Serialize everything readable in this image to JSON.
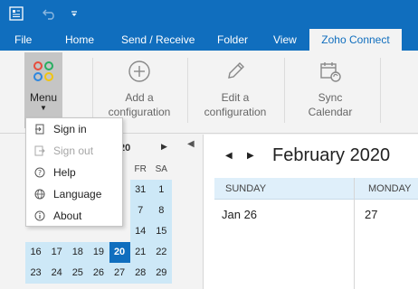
{
  "quick_access": {
    "app_icon": "outlook-icon",
    "undo_icon": "undo-icon",
    "customize_icon": "chevron-down-icon"
  },
  "tabs": [
    {
      "label": "File"
    },
    {
      "label": "Home"
    },
    {
      "label": "Send / Receive"
    },
    {
      "label": "Folder"
    },
    {
      "label": "View"
    },
    {
      "label": "Zoho Connect",
      "active": true
    }
  ],
  "ribbon": {
    "menu_label": "Menu",
    "add_line1": "Add a",
    "add_line2": "configuration",
    "edit_line1": "Edit a",
    "edit_line2": "configuration",
    "sync_line1": "Sync",
    "sync_line2": "Calendar"
  },
  "dropdown": {
    "items": [
      {
        "label": "Sign in",
        "icon": "sign-in-icon",
        "enabled": true
      },
      {
        "label": "Sign out",
        "icon": "sign-out-icon",
        "enabled": false
      },
      {
        "label": "Help",
        "icon": "help-icon",
        "enabled": true
      },
      {
        "label": "Language",
        "icon": "globe-icon",
        "enabled": true
      },
      {
        "label": "About",
        "icon": "info-icon",
        "enabled": true
      }
    ]
  },
  "mini_calendar": {
    "header_day": "20",
    "dow": [
      "",
      "",
      "",
      "",
      "FR",
      "SA"
    ],
    "rows": [
      [
        "",
        "",
        "",
        "",
        "",
        "",
        ""
      ],
      [
        "",
        "",
        "",
        "",
        "",
        "31",
        "1"
      ],
      [
        "",
        "",
        "",
        "",
        "",
        "7",
        "8"
      ],
      [
        "",
        "",
        "",
        "",
        "",
        "14",
        "15"
      ],
      [
        "16",
        "17",
        "18",
        "19",
        "20",
        "21",
        "22"
      ],
      [
        "23",
        "24",
        "25",
        "26",
        "27",
        "28",
        "29"
      ]
    ],
    "selected": "20"
  },
  "main": {
    "month_title": "February 2020",
    "day_headers": [
      "SUNDAY",
      "MONDAY"
    ],
    "dates": [
      "Jan 26",
      "27"
    ]
  },
  "colors": {
    "brand_blue": "#106ebe",
    "cal_blue": "#cde8f7",
    "header_blue": "#dfeffa"
  }
}
